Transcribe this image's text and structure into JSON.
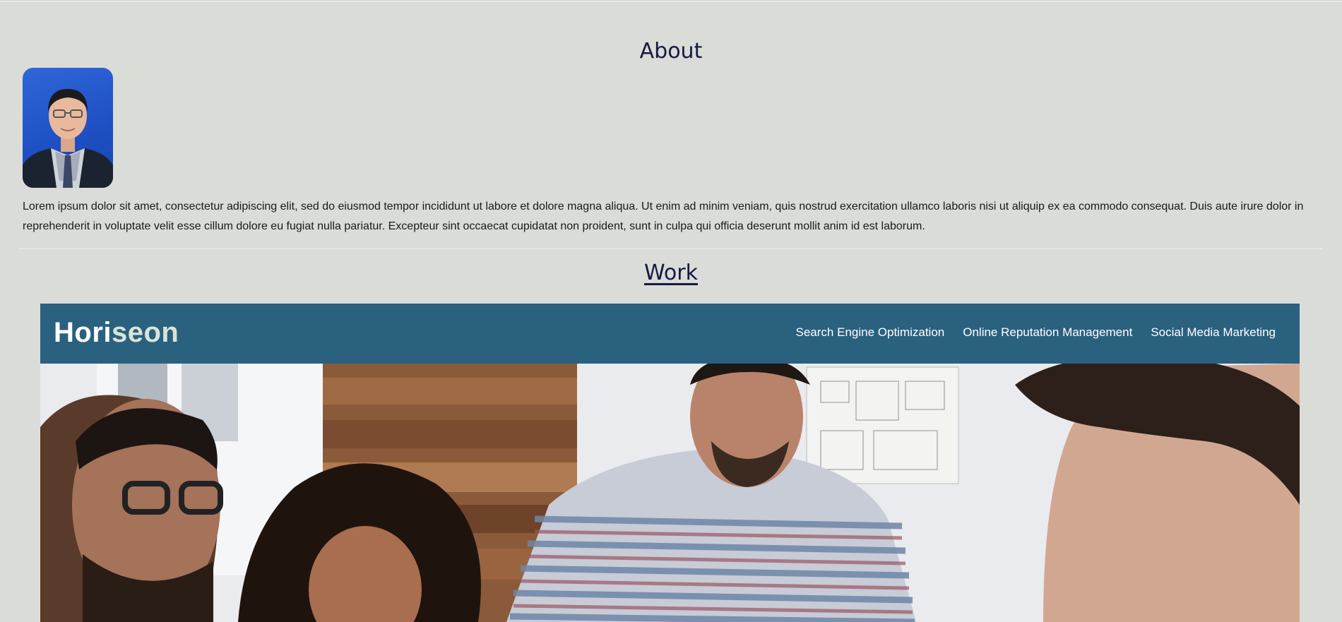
{
  "about": {
    "title": "About",
    "text": "Lorem ipsum dolor sit amet, consectetur adipiscing elit, sed do eiusmod tempor incididunt ut labore et dolore magna aliqua. Ut enim ad minim veniam, quis nostrud exercitation ullamco laboris nisi ut aliquip ex ea commodo consequat. Duis aute irure dolor in reprehenderit in voluptate velit esse cillum dolore eu fugiat nulla pariatur. Excepteur sint occaecat cupidatat non proident, sunt in culpa qui officia deserunt mollit anim id est laborum."
  },
  "work": {
    "title": "Work",
    "project": {
      "logo_part1": "Hori",
      "logo_part2": "seon",
      "nav": [
        "Search Engine Optimization",
        "Online Reputation Management",
        "Social Media Marketing"
      ]
    }
  },
  "colors": {
    "page_bg": "#dadcd7",
    "heading": "#141a45",
    "header_bg": "#2a617f"
  }
}
